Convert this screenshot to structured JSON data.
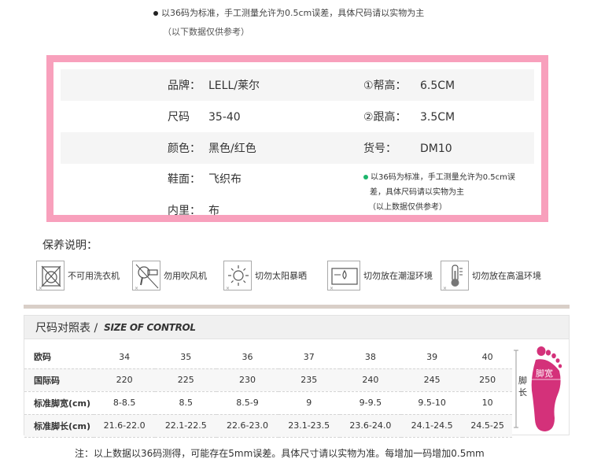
{
  "top_note": {
    "line1": "以36码为标准，手工测量允许为0.5cm误差，具体尺码请以实物为主",
    "line2": "（以下数据仅供参考）"
  },
  "info": {
    "brand_label": "品牌：",
    "brand_value": "LELL/莱尔",
    "size_label": "尺码",
    "size_value": "35-40",
    "color_label": "颜色：",
    "color_value": "黑色/红色",
    "upper_label": "鞋面：",
    "upper_value": "飞织布",
    "lining_label": "内里：",
    "lining_value": "布",
    "heel1_label": "①帮高：",
    "heel1_value": "6.5CM",
    "heel2_label": "②跟高：",
    "heel2_value": "3.5CM",
    "item_label": "货号：",
    "item_value": "DM10",
    "note_line1": "以36码为标准，手工测量允许为0.5cm误",
    "note_line2": "差，具体尺码请以实物为主",
    "note_line3": "（以上数据仅供参考）"
  },
  "care": {
    "title": "保养说明：",
    "items": [
      {
        "label": "不可用洗衣机",
        "icon": "no-washing-machine-icon"
      },
      {
        "label": "勿用吹风机",
        "icon": "no-hair-dryer-icon"
      },
      {
        "label": "切勿太阳暴晒",
        "icon": "no-sun-icon"
      },
      {
        "label": "切勿放在潮湿环境",
        "icon": "no-humidity-icon"
      },
      {
        "label": "切勿放在高温环境",
        "icon": "no-heat-icon"
      }
    ]
  },
  "size_chart": {
    "title_cn": "尺码对照表 /",
    "title_en": "SIZE OF CONTROL",
    "rows": [
      {
        "label": "欧码",
        "values": [
          "34",
          "35",
          "36",
          "37",
          "38",
          "39",
          "40"
        ]
      },
      {
        "label": "国际码",
        "values": [
          "220",
          "225",
          "230",
          "235",
          "240",
          "245",
          "250"
        ]
      },
      {
        "label": "标准脚宽(cm)",
        "values": [
          "8-8.5",
          "8.5",
          "8.5-9",
          "9",
          "9-9.5",
          "9.5-10",
          "10"
        ]
      },
      {
        "label": "标准脚长(cm)",
        "values": [
          "21.6-22.0",
          "22.1-22.5",
          "22.6-23.0",
          "23.1-23.5",
          "23.6-24.0",
          "24.1-24.5",
          "24.5-25"
        ]
      }
    ],
    "foot_length_label_1": "脚",
    "foot_length_label_2": "长",
    "foot_width_label": "脚宽",
    "foot_color": "#d4317a"
  },
  "bottom_note": "注：以上数据以36码测得，可能存在5mm误差。具体尺寸请以实物为准。每增加一码增加0.5mm",
  "colors": {
    "pink_border": "#f8a0bc",
    "accent_green": "#1db56c"
  }
}
